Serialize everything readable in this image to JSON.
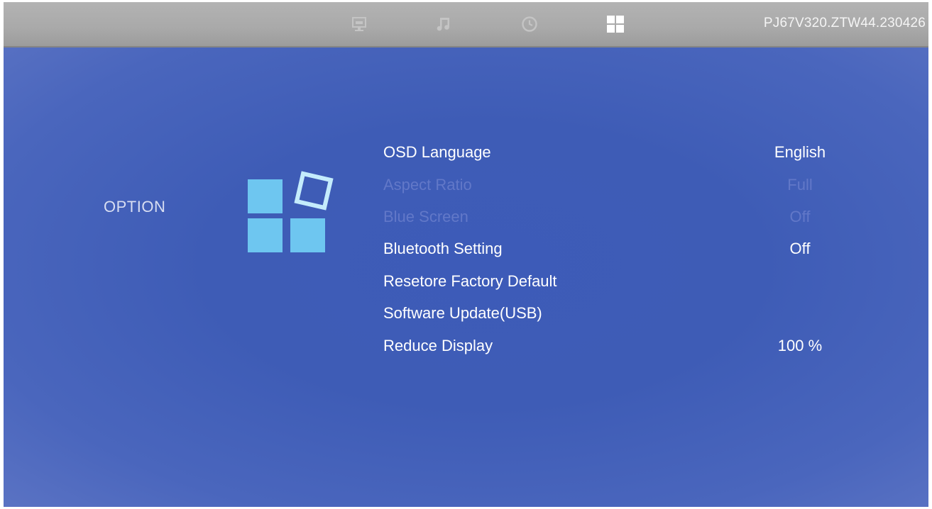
{
  "header": {
    "version": "PJ67V320.ZTW44.230426",
    "tabs": [
      {
        "icon": "picture-icon",
        "active": false
      },
      {
        "icon": "music-note-icon",
        "active": false
      },
      {
        "icon": "clock-icon",
        "active": false
      },
      {
        "icon": "option-grid-icon",
        "active": true
      }
    ]
  },
  "section": {
    "title": "OPTION",
    "icon": "option-grid-icon"
  },
  "menu": {
    "items": [
      {
        "label": "OSD Language",
        "value": "English",
        "enabled": true
      },
      {
        "label": "Aspect Ratio",
        "value": "Full",
        "enabled": false
      },
      {
        "label": "Blue Screen",
        "value": "Off",
        "enabled": false
      },
      {
        "label": "Bluetooth Setting",
        "value": "Off",
        "enabled": true
      },
      {
        "label": "Resetore Factory Default",
        "value": "",
        "enabled": true
      },
      {
        "label": "Software Update(USB)",
        "value": "",
        "enabled": true
      },
      {
        "label": "Reduce Display",
        "value": "100 %",
        "enabled": true
      }
    ]
  },
  "colors": {
    "background": "#3e5cb6",
    "topbar": "#aaaaaa",
    "text_enabled": "#ffffff",
    "text_disabled": "#6278c8",
    "icon_fill": "#6ec6f0"
  }
}
